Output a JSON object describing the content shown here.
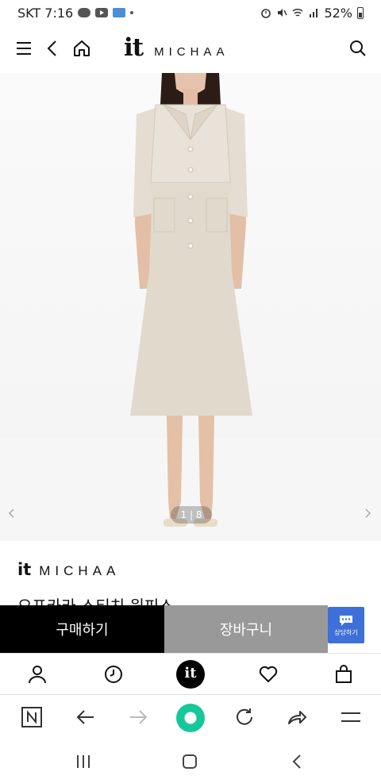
{
  "status_bar": {
    "carrier_time": "SKT 7:16",
    "battery": "52%"
  },
  "header": {
    "logo_it": "it",
    "logo_text": "MICHAA",
    "icons": [
      "menu-icon",
      "back-icon",
      "home-icon",
      "search-icon"
    ]
  },
  "gallery": {
    "counter": "1 | 8"
  },
  "product": {
    "brand_it": "it",
    "brand_name": "MICHAA",
    "name": "오프카라 스티치 원피스"
  },
  "actions": {
    "buy_label": "구매하기",
    "cart_label": "장바구니",
    "chat_label": "상담하기"
  },
  "bottom_nav": {
    "center_logo": "it",
    "icons": [
      "user-icon",
      "clock-icon",
      "it-logo",
      "heart-icon",
      "bag-icon"
    ]
  },
  "browser_bar": {
    "icons": [
      "n-icon",
      "back-arrow-icon",
      "forward-arrow-icon",
      "home-button-icon",
      "refresh-icon",
      "share-icon",
      "menu-icon"
    ]
  },
  "system_nav": {
    "icons": [
      "recents-icon",
      "home-icon",
      "back-icon"
    ]
  },
  "colors": {
    "buy_bg": "#000000",
    "cart_bg": "#999999",
    "chat_bg": "#3f6fd8",
    "browser_home": "#16c79a",
    "dress": "#e2d9cd"
  }
}
